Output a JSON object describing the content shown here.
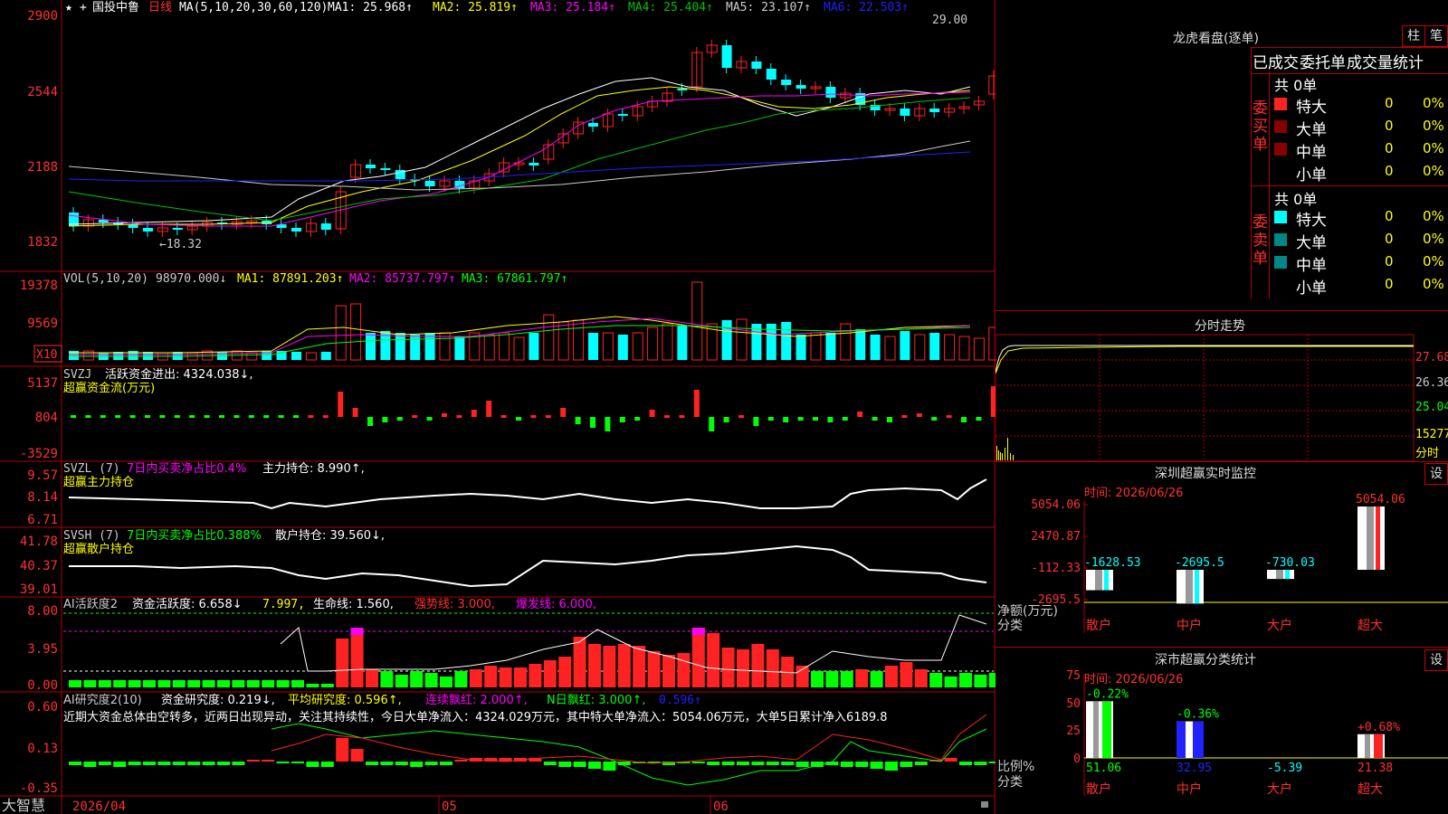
{
  "app": {
    "brand": "大智慧"
  },
  "colors": {
    "bg": "#000000",
    "frame": "#b00000",
    "up": "#ff2222",
    "down": "#00ffff",
    "ma1": "#ffffff",
    "ma2": "#ffff00",
    "ma3": "#ff00ff",
    "ma4": "#00c000",
    "ma5": "#cccccc",
    "ma6": "#2020ff",
    "green": "#00ff00",
    "yellow": "#ffff00",
    "magenta": "#ff00ff"
  },
  "main": {
    "title_star": "★",
    "stock_name": "国投中鲁",
    "period": "日线",
    "ma_label": "MA(5,10,20,30,60,120)",
    "ma_values": [
      "MA1: 25.968↑",
      "MA2: 25.819↑",
      "MA3: 25.184↑",
      "MA4: 25.404↑",
      "MA5: 23.107↑",
      "MA6: 22.503↑"
    ],
    "y_ticks": [
      "2900",
      "2544",
      "2188",
      "1832"
    ],
    "hi_label": "29.00",
    "lo_label": "←18.32",
    "date_labels": [
      "2026/04",
      "05",
      "06"
    ]
  },
  "vol": {
    "label": "VOL(5,10,20)",
    "value": "98970.000↓",
    "ma1": "MA1: 87891.203↑",
    "ma2": "MA2: 85737.797↑",
    "ma3": "MA3: 67861.797↑",
    "y_ticks": [
      "19378",
      "9569"
    ],
    "unit": "X10"
  },
  "svzj": {
    "label": "SVZJ",
    "desc": "活跃资金进出: 4324.038↓,",
    "sub": "超赢资金流(万元)",
    "y_ticks": [
      "5137",
      "804",
      "-3529"
    ]
  },
  "svzl": {
    "label": "SVZL (7)",
    "desc1": "7日内买卖净占比0.4%",
    "desc2": "主力持仓: 8.990↑,",
    "sub": "超赢主力持仓",
    "y_ticks": [
      "9.57",
      "8.14",
      "6.71"
    ]
  },
  "svsh": {
    "label": "SVSH (7)",
    "desc1": "7日内买卖净占比0.388%",
    "desc2": "散户持仓: 39.560↓,",
    "sub": "超赢散户持仓",
    "y_ticks": [
      "41.78",
      "40.37",
      "39.01"
    ]
  },
  "ai": {
    "label": "AI活跃度2",
    "a": "资金活跃度: 6.658↓",
    "b": "7.997,",
    "c": "生命线: 1.560,",
    "d": "强势线: 3.000,",
    "e": "爆发线: 6.000,",
    "y_ticks": [
      "8.00",
      "3.95",
      "0.00"
    ]
  },
  "research": {
    "label": "AI研究度2(10)",
    "a": "资金研究度: 0.219↓,",
    "b": "平均研究度: 0.596↑,",
    "c": "连续飘红: 2.000↑,",
    "d": "N日飘红: 3.000↑,",
    "e": "0.596↑",
    "comment": "近期大资金总体由空转多，近两日出现异动，关注其持续性，今日大单净流入：4324.029万元，其中特大单净流入：5054.06万元，大单5日累计净入6189.8",
    "y_ticks": [
      "0.60",
      "0.13",
      "-0.35"
    ]
  },
  "lhb": {
    "title": "龙虎看盘(逐单)",
    "btn_bar": "柱",
    "btn_order": "笔",
    "tabs": [
      "已成交",
      "委托单",
      "成交量统计"
    ],
    "buy_label": "委买单",
    "sell_label": "委卖单",
    "buy_total": "共 0单",
    "sell_total": "共 0单",
    "rows": [
      {
        "name": "特大",
        "count": "0",
        "pct": "0%"
      },
      {
        "name": "大单",
        "count": "0",
        "pct": "0%"
      },
      {
        "name": "中单",
        "count": "0",
        "pct": "0%"
      },
      {
        "name": "小单",
        "count": "0",
        "pct": "0%"
      }
    ]
  },
  "intraday": {
    "title": "分时走势",
    "y_ticks": [
      "27.68",
      "26.36",
      "25.04",
      "15277"
    ],
    "unit": "分时"
  },
  "sz_monitor": {
    "title": "深圳超赢实时监控",
    "btn": "设",
    "time": "时间: 2026/06/26",
    "y_ticks": [
      "5054.06",
      "2470.87",
      "-112.33",
      "-2695.5"
    ],
    "axis_label": "净额(万元)",
    "axis_label2": "分类",
    "categories": [
      "散户",
      "中户",
      "大户",
      "超大"
    ],
    "values": [
      -1628.53,
      -2695.5,
      -730.03,
      5054.06
    ],
    "value_labels": [
      "-1628.53",
      "-2695.5",
      "-730.03",
      "5054.06"
    ]
  },
  "sz_stats": {
    "title": "深市超赢分类统计",
    "btn": "设",
    "time": "时间: 2026/06/26",
    "y_ticks": [
      "75",
      "50",
      "25",
      "0"
    ],
    "axis_label": "比例%",
    "axis_label2": "分类",
    "categories": [
      "散户",
      "中户",
      "大户",
      "超大"
    ],
    "values": [
      51.06,
      32.95,
      -5.39,
      21.38
    ],
    "value_labels": [
      "51.06",
      "32.95",
      "-5.39",
      "21.38"
    ],
    "change_labels": [
      "-0.22%",
      "-0.36%",
      "",
      "+0.68%"
    ]
  }
}
